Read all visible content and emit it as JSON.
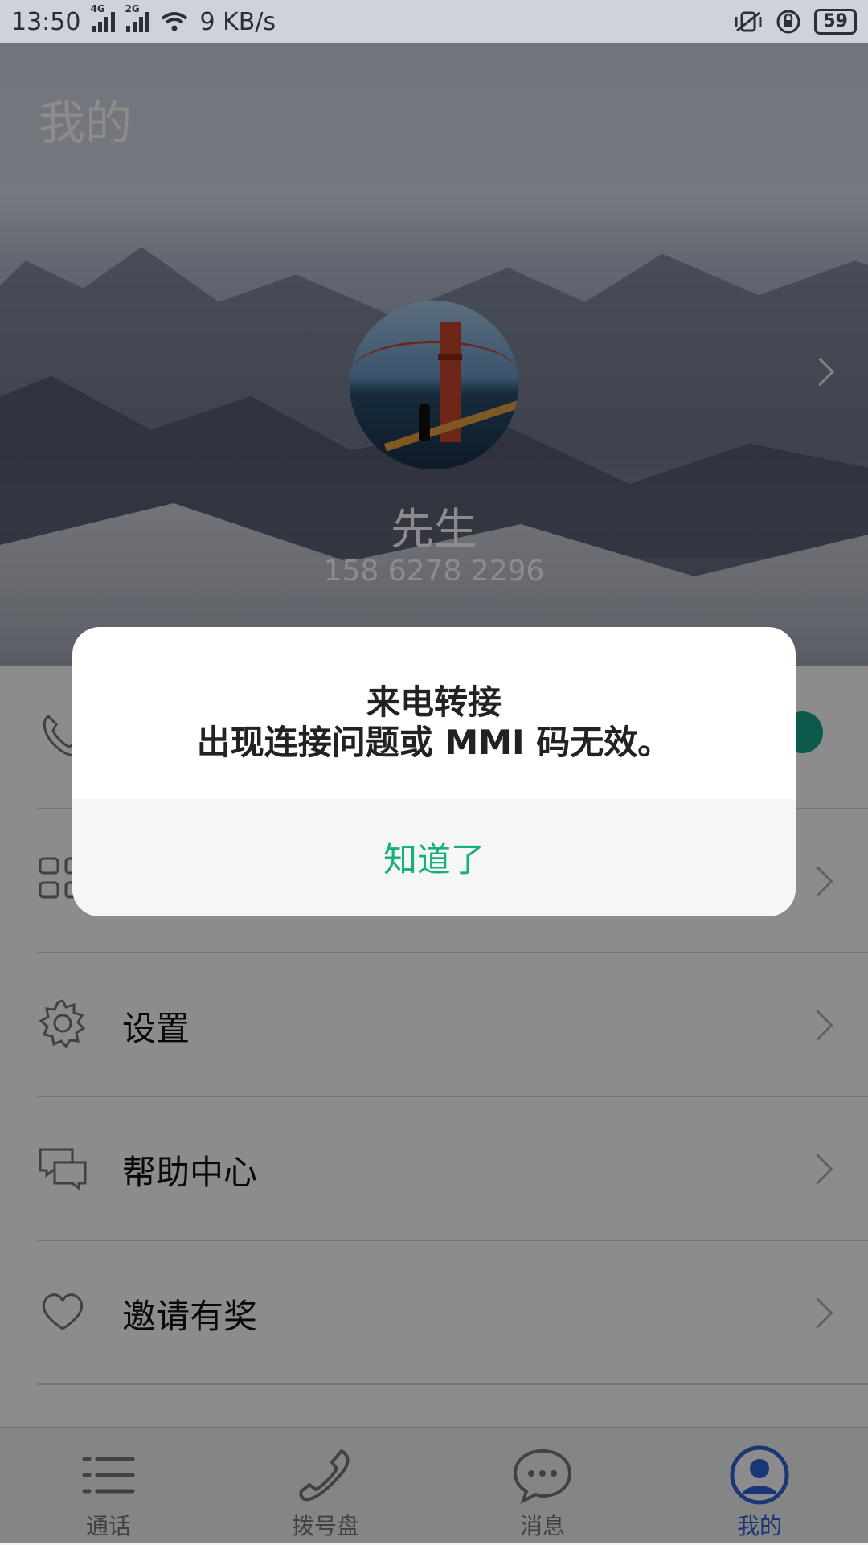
{
  "status_bar": {
    "time": "13:50",
    "net_speed": "9 KB/s",
    "sim1": "4G",
    "sim2": "2G",
    "battery": "59"
  },
  "header": {
    "title": "我的"
  },
  "profile": {
    "name": "先生",
    "phone": "158 6278 2296"
  },
  "menu": {
    "items": [
      {
        "label": "设置",
        "icon": "gear-icon"
      },
      {
        "label": "帮助中心",
        "icon": "chat-icon"
      },
      {
        "label": "邀请有奖",
        "icon": "heart-icon"
      }
    ]
  },
  "dialog": {
    "title": "来电转接",
    "message": "出现连接问题或 MMI 码无效。",
    "button": "知道了"
  },
  "nav": {
    "items": [
      {
        "label": "通话",
        "icon": "list-icon"
      },
      {
        "label": "拨号盘",
        "icon": "phone-icon"
      },
      {
        "label": "消息",
        "icon": "message-icon"
      },
      {
        "label": "我的",
        "icon": "profile-icon",
        "active": true
      }
    ],
    "active_color": "#2f63d6"
  },
  "colors": {
    "accent": "#17b07a",
    "toggle": "#17a58a"
  }
}
